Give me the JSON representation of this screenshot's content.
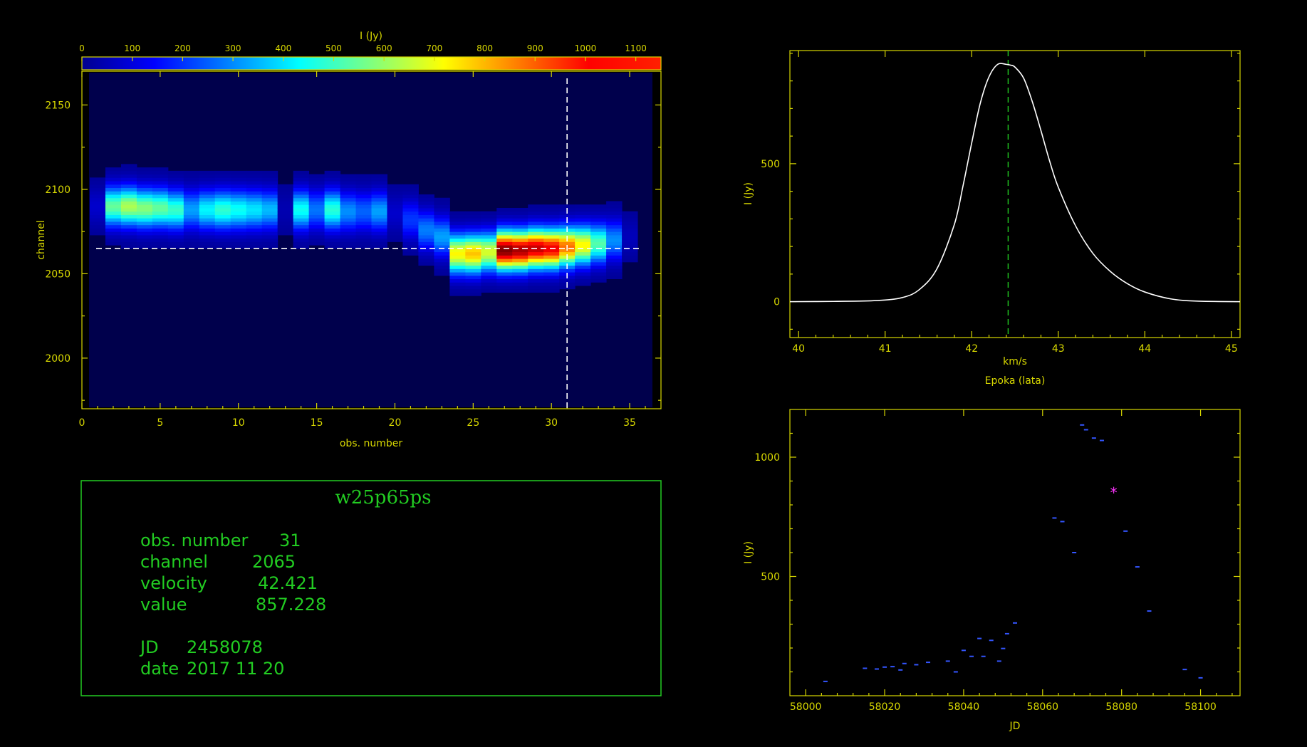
{
  "colorbar": {
    "title": "I (Jy)",
    "ticks": [
      0,
      100,
      200,
      300,
      400,
      500,
      600,
      700,
      800,
      900,
      1000,
      1100
    ],
    "range": [
      0,
      1150
    ]
  },
  "info_panel": {
    "title": "w25p65ps",
    "obs_label": "obs. number",
    "obs_value": "31",
    "channel_label": "channel",
    "channel_value": "2065",
    "velocity_label": "velocity",
    "velocity_value": "42.421",
    "value_label": "value",
    "value_value": "857.228",
    "jd_label": "JD",
    "jd_value": "2458078",
    "date_label": "date",
    "date_value": "2017 11 20"
  },
  "chart_data": [
    {
      "type": "heatmap",
      "xlabel": "obs. number",
      "ylabel": "channel",
      "xlim": [
        0,
        37
      ],
      "ylim": [
        1970,
        2170
      ],
      "xticks": [
        0,
        5,
        10,
        15,
        20,
        25,
        30,
        35
      ],
      "yticks": [
        2000,
        2050,
        2100,
        2150
      ],
      "crosshair": {
        "x": 31,
        "y": 2065
      },
      "columns": [
        {
          "obs": 1,
          "center": 2090,
          "peak": 60
        },
        {
          "obs": 2,
          "center": 2090,
          "peak": 520
        },
        {
          "obs": 3,
          "center": 2090,
          "peak": 600
        },
        {
          "obs": 4,
          "center": 2089,
          "peak": 560
        },
        {
          "obs": 5,
          "center": 2089,
          "peak": 520
        },
        {
          "obs": 6,
          "center": 2088,
          "peak": 470
        },
        {
          "obs": 7,
          "center": 2088,
          "peak": 300
        },
        {
          "obs": 8,
          "center": 2088,
          "peak": 400
        },
        {
          "obs": 9,
          "center": 2088,
          "peak": 460
        },
        {
          "obs": 10,
          "center": 2088,
          "peak": 420
        },
        {
          "obs": 11,
          "center": 2088,
          "peak": 380
        },
        {
          "obs": 12,
          "center": 2088,
          "peak": 330
        },
        {
          "obs": 13,
          "center": 2088,
          "peak": 30
        },
        {
          "obs": 14,
          "center": 2088,
          "peak": 420
        },
        {
          "obs": 15,
          "center": 2088,
          "peak": 250
        },
        {
          "obs": 16,
          "center": 2088,
          "peak": 450
        },
        {
          "obs": 17,
          "center": 2087,
          "peak": 280
        },
        {
          "obs": 18,
          "center": 2087,
          "peak": 230
        },
        {
          "obs": 19,
          "center": 2087,
          "peak": 300
        },
        {
          "obs": 20,
          "center": 2086,
          "peak": 60
        },
        {
          "obs": 21,
          "center": 2082,
          "peak": 180
        },
        {
          "obs": 22,
          "center": 2076,
          "peak": 260
        },
        {
          "obs": 23,
          "center": 2072,
          "peak": 300
        },
        {
          "obs": 24,
          "center": 2062,
          "peak": 700
        },
        {
          "obs": 25,
          "center": 2062,
          "peak": 760
        },
        {
          "obs": 26,
          "center": 2063,
          "peak": 650
        },
        {
          "obs": 27,
          "center": 2064,
          "peak": 1130
        },
        {
          "obs": 28,
          "center": 2064,
          "peak": 1080
        },
        {
          "obs": 29,
          "center": 2065,
          "peak": 1050
        },
        {
          "obs": 30,
          "center": 2065,
          "peak": 1000
        },
        {
          "obs": 31,
          "center": 2066,
          "peak": 857
        },
        {
          "obs": 32,
          "center": 2067,
          "peak": 700
        },
        {
          "obs": 33,
          "center": 2068,
          "peak": 500
        },
        {
          "obs": 34,
          "center": 2070,
          "peak": 280
        },
        {
          "obs": 35,
          "center": 2072,
          "peak": 40
        }
      ]
    },
    {
      "type": "line",
      "title": "Epoka (lata)",
      "xlabel": "km/s",
      "ylabel": "I (Jy)",
      "xlim": [
        39.9,
        45.1
      ],
      "ylim": [
        -130,
        910
      ],
      "xticks": [
        40,
        41,
        42,
        43,
        44,
        45
      ],
      "yticks": [
        0,
        500
      ],
      "marker_x": 42.421,
      "x": [
        39.9,
        40.4,
        40.9,
        41.2,
        41.4,
        41.6,
        41.8,
        41.9,
        42.0,
        42.1,
        42.2,
        42.3,
        42.4,
        42.45,
        42.5,
        42.6,
        42.7,
        42.8,
        42.9,
        43.0,
        43.2,
        43.4,
        43.6,
        43.8,
        44.0,
        44.3,
        44.6,
        45.1
      ],
      "y": [
        0,
        1,
        4,
        15,
        45,
        120,
        280,
        420,
        575,
        720,
        815,
        860,
        860,
        857,
        850,
        810,
        725,
        620,
        510,
        415,
        275,
        175,
        110,
        65,
        35,
        10,
        2,
        0
      ]
    },
    {
      "type": "scatter",
      "xlabel": "JD",
      "ylabel": "I (Jy)",
      "xlim": [
        57996,
        58110
      ],
      "ylim": [
        0,
        1200
      ],
      "xticks": [
        58000,
        58020,
        58040,
        58060,
        58080,
        58100
      ],
      "yticks": [
        500,
        1000
      ],
      "points": [
        {
          "x": 58005,
          "y": 60
        },
        {
          "x": 58015,
          "y": 115
        },
        {
          "x": 58018,
          "y": 112
        },
        {
          "x": 58020,
          "y": 120
        },
        {
          "x": 58022,
          "y": 122
        },
        {
          "x": 58024,
          "y": 108
        },
        {
          "x": 58025,
          "y": 135
        },
        {
          "x": 58028,
          "y": 130
        },
        {
          "x": 58031,
          "y": 140
        },
        {
          "x": 58036,
          "y": 145
        },
        {
          "x": 58038,
          "y": 100
        },
        {
          "x": 58040,
          "y": 190
        },
        {
          "x": 58042,
          "y": 165
        },
        {
          "x": 58044,
          "y": 240
        },
        {
          "x": 58045,
          "y": 165
        },
        {
          "x": 58047,
          "y": 232
        },
        {
          "x": 58049,
          "y": 145
        },
        {
          "x": 58050,
          "y": 198
        },
        {
          "x": 58051,
          "y": 260
        },
        {
          "x": 58053,
          "y": 305
        },
        {
          "x": 58063,
          "y": 745
        },
        {
          "x": 58065,
          "y": 730
        },
        {
          "x": 58068,
          "y": 600
        },
        {
          "x": 58070,
          "y": 1135
        },
        {
          "x": 58071,
          "y": 1115
        },
        {
          "x": 58073,
          "y": 1080
        },
        {
          "x": 58075,
          "y": 1070
        },
        {
          "x": 58081,
          "y": 690
        },
        {
          "x": 58084,
          "y": 540
        },
        {
          "x": 58087,
          "y": 355
        },
        {
          "x": 58096,
          "y": 110
        },
        {
          "x": 58100,
          "y": 75
        }
      ],
      "highlight": {
        "x": 58078,
        "y": 857
      }
    }
  ]
}
